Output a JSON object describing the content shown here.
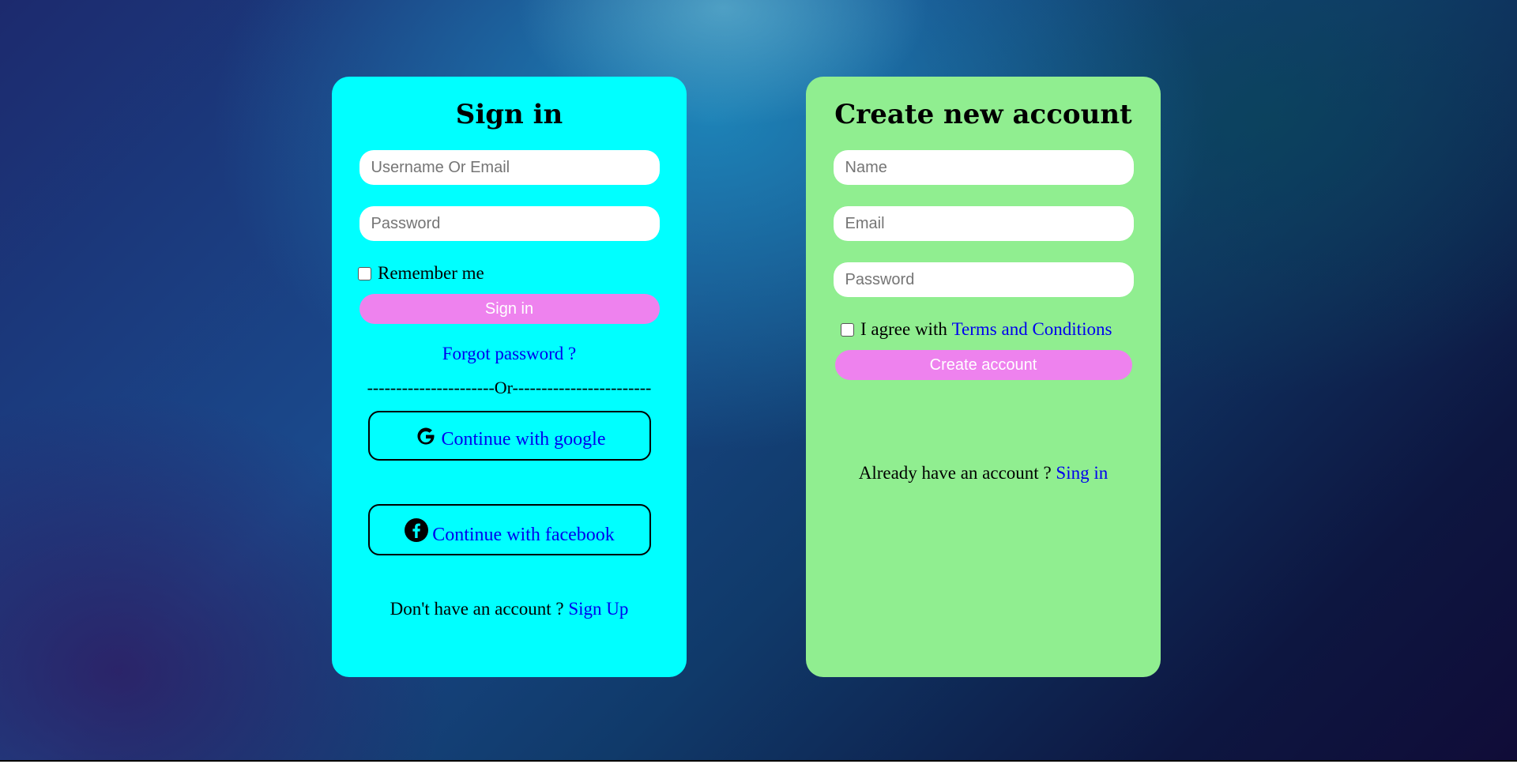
{
  "signin": {
    "title": "Sign in",
    "username_placeholder": "Username Or Email",
    "password_placeholder": "Password",
    "remember_label": "Remember me",
    "submit_label": "Sign in",
    "forgot_link": "Forgot password ?",
    "divider": "----------------------Or------------------------",
    "google_label": "Continue with google",
    "facebook_label": "Continue with facebook",
    "footer_text": "Don't have an account ? ",
    "footer_link": "Sign Up",
    "background": "#00ffff"
  },
  "signup": {
    "title": "Create new account",
    "name_placeholder": "Name",
    "email_placeholder": "Email",
    "password_placeholder": "Password",
    "agree_text": "I agree with ",
    "terms_link": "Terms and Conditions",
    "submit_label": "Create account",
    "footer_text": "Already have an account ? ",
    "footer_link": "Sing in",
    "background": "#90ee90"
  },
  "colors": {
    "button": "#ee82ee",
    "link": "#0000ee"
  },
  "icons": {
    "google": "google-icon",
    "facebook": "facebook-icon"
  }
}
